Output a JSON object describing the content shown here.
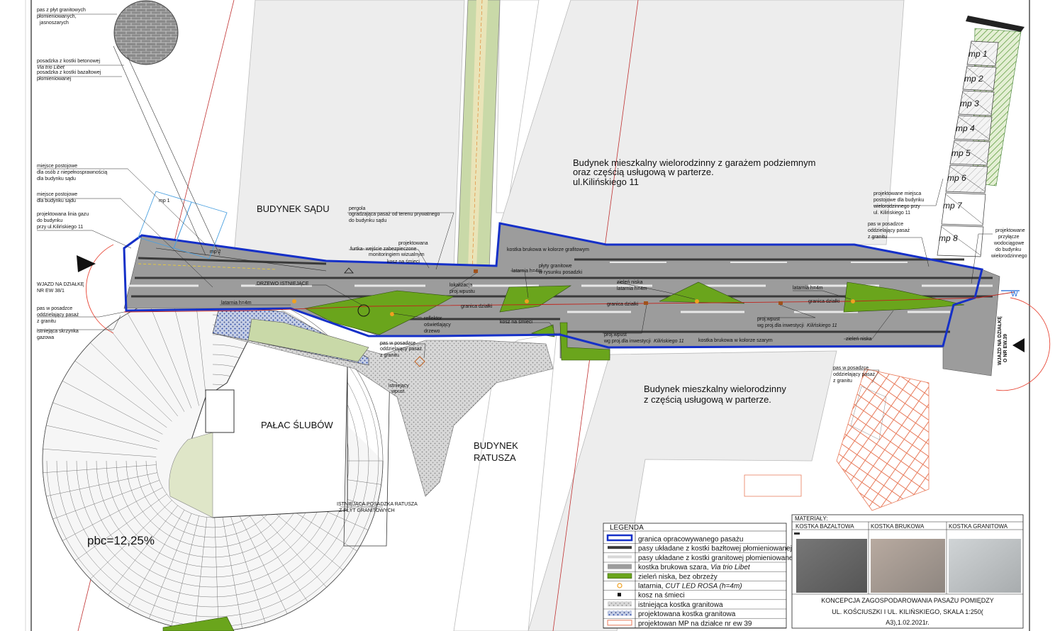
{
  "colors": {
    "boundary": "#1530c8",
    "basalt": "#3a3a3a",
    "granite_stripe": "#e8e8e8",
    "paving_gray": "#9c9c9c",
    "green": "#6aa51c",
    "lamp": "#f0a020",
    "gas_line": "#c0241c",
    "parking_red": "#e87a5a"
  },
  "buildings": {
    "sad": "BUDYNEK SĄDU",
    "residential_top_1": "Budynek mieszkalny wielorodzinny z garażem podziemnym",
    "residential_top_2": "oraz częścią usługową w parterze.",
    "residential_top_3": "ul.Kilińskiego 11",
    "residential_bottom_1": "Budynek mieszkalny wielorodzinny",
    "residential_bottom_2": "z częścią usługową w parterze.",
    "palac": "PAŁAC ŚLUBÓW",
    "ratusz_1": "BUDYNEK",
    "ratusz_2": "RATUSZA",
    "pbc": "pbc=12,25%"
  },
  "detail_labels": {
    "a1": "pas z płyt granitowych",
    "a2": "płomieniowanych,",
    "a3": "jasnoszarych",
    "b1": "posadzka z kostki betonowej",
    "b2": "Via trio Libet",
    "c1": "posadzka z kostki bazaltowej",
    "c2": "płomieniowanej"
  },
  "annotations": {
    "mp_inv_1": "miejsce postojowe",
    "mp_inv_2": "dla osób z niepełnosprawnością",
    "mp_inv_3": "dla budynku sądu",
    "mp_1": "miejsce postojowe",
    "mp_2": "dla budynku sądu",
    "gas_1": "projektowana linia gazu",
    "gas_2": "do budynku",
    "gas_3": "przy ul.Kilińskiego 11",
    "wjazd_1": "WJAZD NA DZIAŁKĘ",
    "wjazd_2": "NR EW 38/1",
    "pas_gr_1": "pas w posadzce",
    "pas_gr_2": "oddzielający pasaż",
    "pas_gr_3": "z granitu",
    "skrzynka_1": "istniejąca skrzynka",
    "skrzynka_2": "gazowa",
    "pergola_1": "pergola",
    "pergola_2": "ogradzająca pasaż od terenu prywatnego",
    "pergola_3": "do budynku sądu",
    "furtka_1": "projektowana",
    "furtka_2": "furtka- wejście zabezpieczone",
    "furtka_3": "monitoringiem wizualnym",
    "kosz_top": "kosz na śmieci",
    "drzewo": "DRZEWO ISTNIEJĄCE",
    "latarnia_1": "latarnia h=4m",
    "latarnia_2": "latarnia h=4m",
    "latarnia_3": "latarnia h=4m",
    "latarnia_4": "latarnia h=4m",
    "lok_wpust_1": "lokalizacja",
    "lok_wpust_2": "proj.wpustu",
    "plyty_1": "płyty granitowe",
    "plyty_2": "w rysunku posadzki",
    "kostka_graf": "kostka brukowa  w kolorze grafitowym",
    "zielen_1": "zieleń niska",
    "granica_1": "granica działki",
    "granica_2": "granica działki",
    "granica_3": "granica działki",
    "reflektor_1": "reflektor",
    "reflektor_2": "oświetlający",
    "reflektor_3": "drzewo",
    "kosz_bottom": "kosz na śmieci",
    "pas_mid_1": "pas w posadzce",
    "pas_mid_2": "oddzielający pasaż",
    "pas_mid_3": "z granitu",
    "wpust_istn_1": "istniejący",
    "wpust_istn_2": "wpust",
    "proj_wpust_a": "proj.wpust",
    "proj_wpust_b": "wg proj.dla inwestycji",
    "proj_wpust_c": "Kilińskiego 11",
    "kostka_szara": "kostka brukowa  w kolorze szarym",
    "proj_wpust2_a": "proj.wpust",
    "proj_wpust2_b": "wg proj.dla inwestycji",
    "proj_wpust2_c": "Kilińskiego 11",
    "zielen_2": "zieleń niska",
    "pas_right_1": "pas w posadzce",
    "pas_right_2": "oddzielający pasaż",
    "pas_right_3": "z granitu",
    "pas_br_1": "pas w posadzce",
    "pas_br_2": "oddzielający pasaż",
    "pas_br_3": "z granitu",
    "proj_mp_1": "projektowane miejsca",
    "proj_mp_2": "postojowe dla budynku",
    "proj_mp_3": "wielorodzinnego przy",
    "proj_mp_4": "ul. Kilińskiego 11",
    "przyl_1": "projektowane",
    "przyl_2": "przyłącze",
    "przyl_3": "wodociągowe",
    "przyl_4": "do budynku",
    "przyl_5": "wielorodzinnego",
    "wjazd_r_1": "WJAZD NA DZIAŁKĘ",
    "wjazd_r_2": "O NR EW.39",
    "w_letter": "W",
    "posadzka_ratusz_1": "ISTNIEJĄCA POSADZKA RATUSZA",
    "posadzka_ratusz_2": "Z PŁYT GRANITOWYCH",
    "mp1_left": "mp 1",
    "mp2_left": "mp 2"
  },
  "parking": [
    "mp 1",
    "mp 2",
    "mp 3",
    "mp 4",
    "mp 5",
    "mp 6",
    "mp 7",
    "mp 8"
  ],
  "legend": {
    "title": "LEGENDA",
    "items": [
      "granica opracowywanego pasażu",
      "pasy układane z kostki bazłtowej płomieniowanej",
      "pasy układane z kostki granitowej płomieniowanej",
      "kostka brukowa szara, Via trio Libet",
      "zieleń niska, bez obrzeży",
      "latarnia, CUT LED ROSA (h=4m)",
      "kosz na śmieci",
      "istniejąca kostka granitowa",
      "projektowana kostka granitowa",
      "projektowan MP na działce nr ew 39"
    ]
  },
  "materials": {
    "title": "MATERIAŁY:",
    "m1": "KOSTKA BAZALTOWA",
    "m2": "KOSTKA BRUKOWA",
    "m3": "KOSTKA GRANITOWA"
  },
  "title_block": {
    "line1": "KONCEPCJA ZAGOSPODAROWANIA PASAŻU POMIĘDZY",
    "line2": "UL. KOŚCIUSZKI I UL. KILIŃSKIEGO, SKALA 1:250(",
    "line3": "A3),1.02.2021r."
  }
}
